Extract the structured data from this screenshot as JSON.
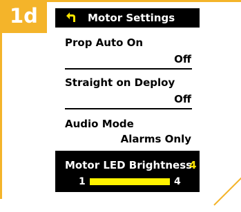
{
  "step": {
    "label": "1d"
  },
  "header": {
    "title": "Motor Settings",
    "back_icon": "back-arrow-icon"
  },
  "settings": [
    {
      "label": "Prop Auto On",
      "value": "Off"
    },
    {
      "label": "Straight on Deploy",
      "value": "Off"
    },
    {
      "label": "Audio Mode",
      "value": "Alarms Only"
    }
  ],
  "selected": {
    "label": "Motor LED Brightness",
    "value": "4",
    "slider": {
      "min_label": "1",
      "max_label": "4",
      "min": 1,
      "max": 4,
      "current": 4
    }
  },
  "colors": {
    "accent": "#F4B42A",
    "highlight": "#FFE600",
    "screen_bg": "#000000"
  }
}
